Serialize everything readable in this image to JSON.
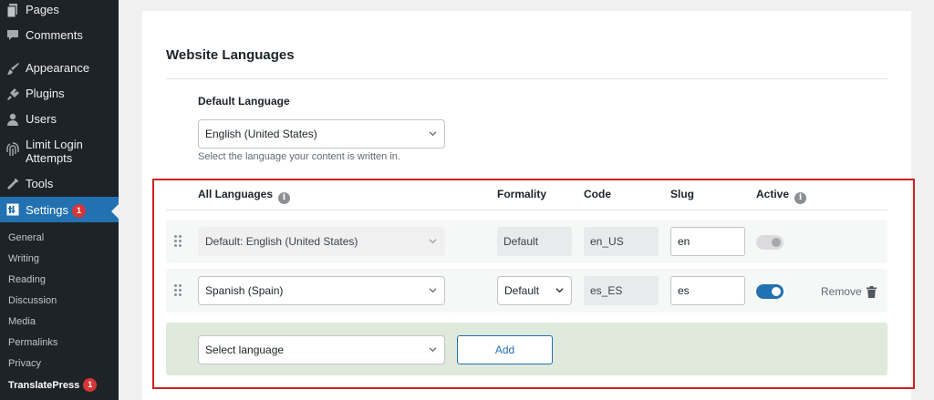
{
  "sidebar": {
    "items": [
      {
        "label": "Pages",
        "icon": "pages-icon"
      },
      {
        "label": "Comments",
        "icon": "comments-icon"
      },
      {
        "label": "Appearance",
        "icon": "appearance-icon"
      },
      {
        "label": "Plugins",
        "icon": "plugins-icon"
      },
      {
        "label": "Users",
        "icon": "users-icon"
      },
      {
        "label": "Limit Login Attempts",
        "icon": "fingerprint-icon"
      },
      {
        "label": "Tools",
        "icon": "tools-icon"
      },
      {
        "label": "Settings",
        "icon": "settings-icon",
        "badge": "1"
      }
    ],
    "submenu": [
      {
        "label": "General"
      },
      {
        "label": "Writing"
      },
      {
        "label": "Reading"
      },
      {
        "label": "Discussion"
      },
      {
        "label": "Media"
      },
      {
        "label": "Permalinks"
      },
      {
        "label": "Privacy"
      },
      {
        "label": "TranslatePress",
        "badge": "1"
      }
    ]
  },
  "main": {
    "title": "Website Languages",
    "default_language": {
      "heading": "Default Language",
      "value": "English (United States)",
      "help": "Select the language your content is written in."
    },
    "columns": {
      "all_languages": "All Languages",
      "formality": "Formality",
      "code": "Code",
      "slug": "Slug",
      "active": "Active"
    },
    "rows": [
      {
        "language": "Default: English (United States)",
        "formality": "Default",
        "code": "en_US",
        "slug": "en",
        "active": true,
        "toggle_disabled": true
      },
      {
        "language": "Spanish (Spain)",
        "formality": "Default",
        "code": "es_ES",
        "slug": "es",
        "active": true,
        "remove_label": "Remove"
      }
    ],
    "add": {
      "placeholder": "Select language",
      "button": "Add"
    }
  },
  "colors": {
    "sidebar_bg": "#1d2327",
    "accent": "#2271b1",
    "badge": "#d63638",
    "highlight_box": "#d01f1f",
    "add_row_bg": "#dfe9dc"
  }
}
